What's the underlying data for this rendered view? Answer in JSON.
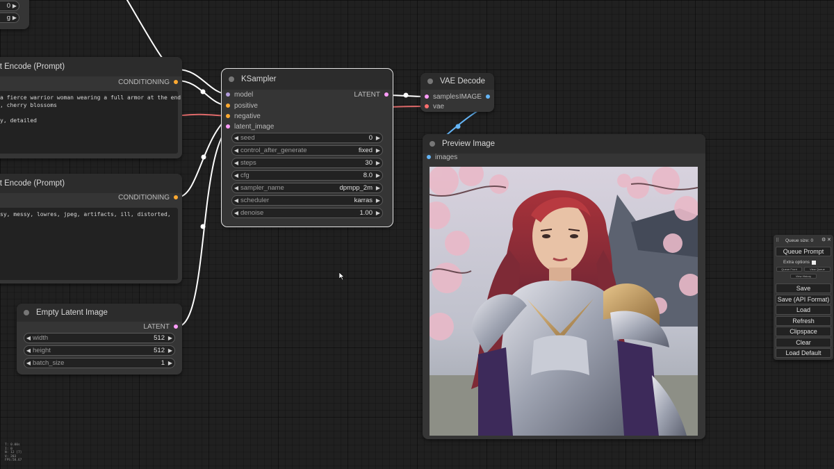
{
  "colors": {
    "model": "#b39ddb",
    "conditioning": "#ffa931",
    "latent": "#ff9cf9",
    "vae": "#ff6e6e",
    "image": "#64b5f6"
  },
  "top_stub": {
    "row1_value": "0",
    "row2_value": "g"
  },
  "positive_prompt": {
    "title": "xt Encode (Prompt)",
    "output_label": "CONDITIONING",
    "text": "a fierce warrior woman wearing a full armor at the end\n, cherry blossoms\n\ny, detailed"
  },
  "negative_prompt": {
    "title": "xt Encode (Prompt)",
    "output_label": "CONDITIONING",
    "text": "sy, messy, lowres, jpeg, artifacts, ill, distorted,"
  },
  "ksampler": {
    "title": "KSampler",
    "inputs": [
      "model",
      "positive",
      "negative",
      "latent_image"
    ],
    "output_label": "LATENT",
    "widgets": [
      {
        "label": "seed",
        "value": "0"
      },
      {
        "label": "control_after_generate",
        "value": "fixed"
      },
      {
        "label": "steps",
        "value": "30"
      },
      {
        "label": "cfg",
        "value": "8.0"
      },
      {
        "label": "sampler_name",
        "value": "dpmpp_2m"
      },
      {
        "label": "scheduler",
        "value": "karras"
      },
      {
        "label": "denoise",
        "value": "1.00"
      }
    ]
  },
  "vae_decode": {
    "title": "VAE Decode",
    "inputs": [
      "samples",
      "vae"
    ],
    "output_label": "IMAGE"
  },
  "preview_image": {
    "title": "Preview Image",
    "input_label": "images"
  },
  "empty_latent": {
    "title": "Empty Latent Image",
    "output_label": "LATENT",
    "widgets": [
      {
        "label": "width",
        "value": "512"
      },
      {
        "label": "height",
        "value": "512"
      },
      {
        "label": "batch_size",
        "value": "1"
      }
    ]
  },
  "menu": {
    "queue_size": "Queue size: 0",
    "queue_prompt": "Queue Prompt",
    "extra_options": "Extra options",
    "queue_front": "Queue Front",
    "view_queue": "View Queue",
    "view_history": "View History",
    "save": "Save",
    "save_api": "Save (API Format)",
    "load": "Load",
    "refresh": "Refresh",
    "clipspace": "Clipspace",
    "clear": "Clear",
    "load_default": "Load Default"
  },
  "stats": [
    "T: 0.00s",
    "I: 0",
    "N: 12 [7]",
    "V: 283",
    "FPS:58.67"
  ]
}
